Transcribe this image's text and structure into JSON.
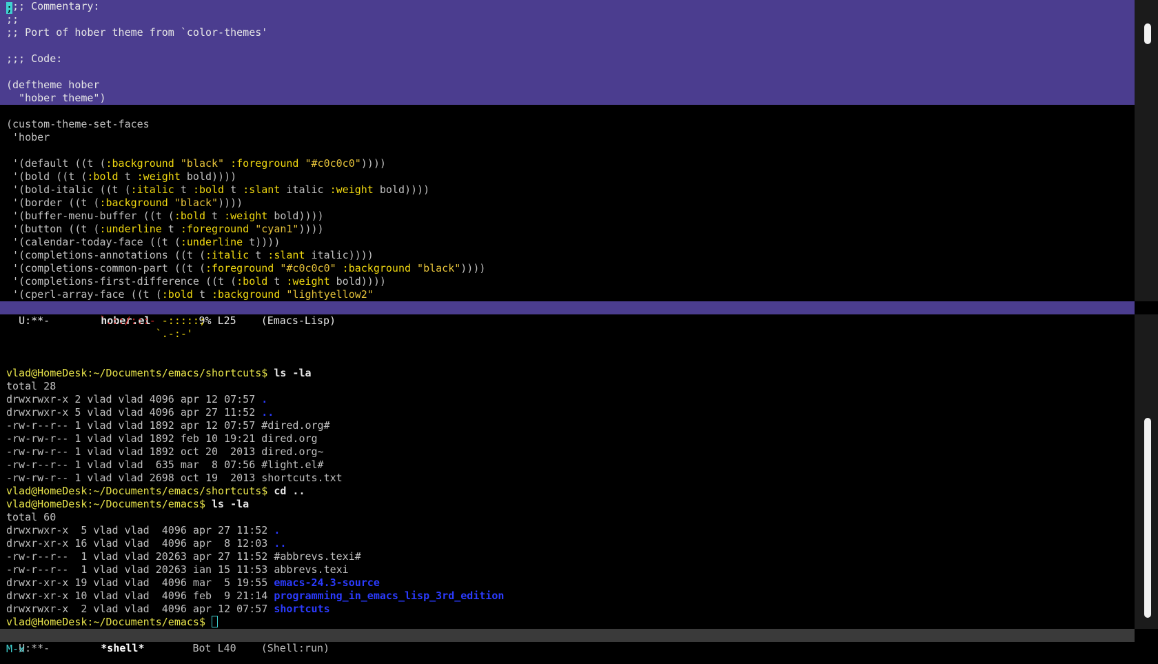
{
  "editor": {
    "selected_lines": [
      ";;; Commentary:",
      ";;",
      ";; Port of hober theme from `color-themes'",
      "",
      ";;; Code:",
      "",
      "(deftheme hober",
      "  \"hober theme\")"
    ],
    "code_lines": [
      "",
      "(custom-theme-set-faces",
      " 'hober",
      "",
      " '(default ((t (:background \"black\" :foreground \"#c0c0c0\"))))",
      " '(bold ((t (:bold t :weight bold))))",
      " '(bold-italic ((t (:italic t :bold t :slant italic :weight bold))))",
      " '(border ((t (:background \"black\"))))",
      " '(buffer-menu-buffer ((t (:bold t :weight bold))))",
      " '(button ((t (:underline t :foreground \"cyan1\"))))",
      " '(calendar-today-face ((t (:underline t))))",
      " '(completions-annotations ((t (:italic t :slant italic))))",
      " '(completions-common-part ((t (:foreground \"#c0c0c0\" :background \"black\"))))",
      " '(completions-first-difference ((t (:bold t :weight bold))))",
      " '(cperl-array-face ((t (:bold t :background \"lightyellow2\""
    ],
    "modeline": {
      "status": "U:**-",
      "buffer": "hober.el",
      "position": "9% L25",
      "mode": "(Emacs-Lisp)"
    }
  },
  "shell": {
    "ascii_art": [
      {
        "red": "`.::/:::-",
        "yellow": " -:::::;"
      },
      {
        "red": "",
        "yellow": "`.-:-'"
      }
    ],
    "prompt1": "vlad@HomeDesk:~/Documents/emacs/shortcuts$",
    "command1": "ls -la",
    "listing1_total": "total 28",
    "listing1": [
      {
        "meta": "drwxrwxr-x 2 vlad vlad 4096 apr 12 07:57 ",
        "name": ".",
        "dir": true
      },
      {
        "meta": "drwxrwxr-x 5 vlad vlad 4096 apr 27 11:52 ",
        "name": "..",
        "dir": true
      },
      {
        "meta": "-rw-r--r-- 1 vlad vlad 1892 apr 12 07:57 ",
        "name": "#dired.org#",
        "dir": false
      },
      {
        "meta": "-rw-rw-r-- 1 vlad vlad 1892 feb 10 19:21 ",
        "name": "dired.org",
        "dir": false
      },
      {
        "meta": "-rw-rw-r-- 1 vlad vlad 1892 oct 20  2013 ",
        "name": "dired.org~",
        "dir": false
      },
      {
        "meta": "-rw-r--r-- 1 vlad vlad  635 mar  8 07:56 ",
        "name": "#light.el#",
        "dir": false
      },
      {
        "meta": "-rw-rw-r-- 1 vlad vlad 2698 oct 19  2013 ",
        "name": "shortcuts.txt",
        "dir": false
      }
    ],
    "prompt2": "vlad@HomeDesk:~/Documents/emacs/shortcuts$",
    "command2": "cd ..",
    "prompt3": "vlad@HomeDesk:~/Documents/emacs$",
    "command3": "ls -la",
    "listing2_total": "total 60",
    "listing2": [
      {
        "meta": "drwxrwxr-x  5 vlad vlad  4096 apr 27 11:52 ",
        "name": ".",
        "dir": true
      },
      {
        "meta": "drwxr-xr-x 16 vlad vlad  4096 apr  8 12:03 ",
        "name": "..",
        "dir": true
      },
      {
        "meta": "-rw-r--r--  1 vlad vlad 20263 apr 27 11:52 ",
        "name": "#abbrevs.texi#",
        "dir": false
      },
      {
        "meta": "-rw-r--r--  1 vlad vlad 20263 ian 15 11:53 ",
        "name": "abbrevs.texi",
        "dir": false
      },
      {
        "meta": "drwxr-xr-x 19 vlad vlad  4096 mar  5 19:55 ",
        "name": "emacs-24.3-source",
        "dir": true
      },
      {
        "meta": "drwxr-xr-x 10 vlad vlad  4096 feb  9 21:14 ",
        "name": "programming_in_emacs_lisp_3rd_edition",
        "dir": true
      },
      {
        "meta": "drwxrwxr-x  2 vlad vlad  4096 apr 12 07:57 ",
        "name": "shortcuts",
        "dir": true
      }
    ],
    "prompt4": "vlad@HomeDesk:~/Documents/emacs$",
    "modeline": {
      "status": "U:**-",
      "buffer": "*shell*",
      "position": "Bot L40",
      "mode": "(Shell:run)"
    }
  },
  "minibuffer": {
    "text": "M-x"
  },
  "colors": {
    "selection": "#4b3d8f",
    "prompt": "#e7e34a",
    "directory": "#2b3bff",
    "minibuffer": "#3fd0d0"
  }
}
